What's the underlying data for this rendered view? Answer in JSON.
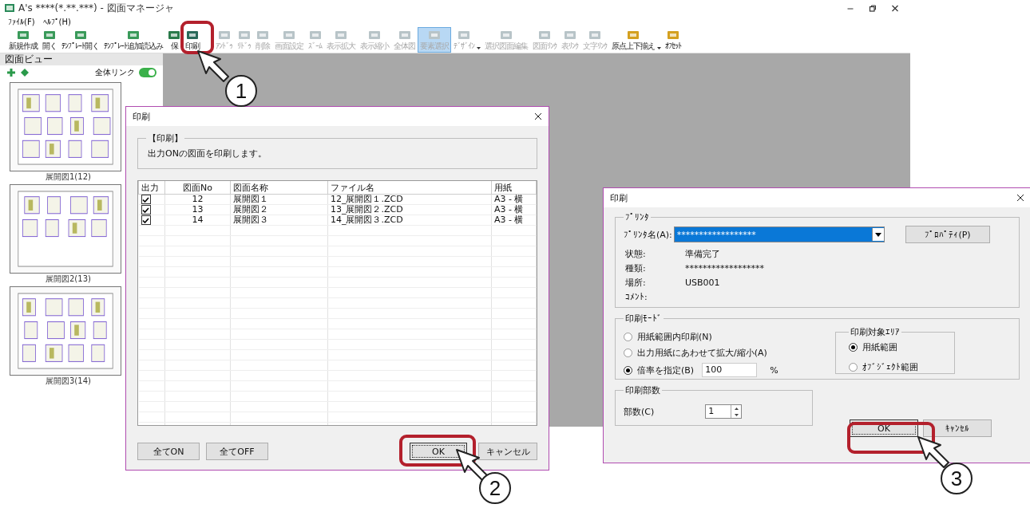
{
  "window": {
    "title": "A's ****(*.**.***) - 図面マネージャ",
    "menu": [
      "ﾌｧｲﾙ(F)",
      "ﾍﾙﾌﾟ(H)"
    ],
    "toolbar": [
      {
        "label": "新規作成",
        "disabled": false,
        "selected": false,
        "dropdown": false
      },
      {
        "label": "開く",
        "disabled": false,
        "selected": false,
        "dropdown": false
      },
      {
        "label": "ﾃﾝﾌﾟﾚｰﾄ開く",
        "disabled": false,
        "selected": false,
        "dropdown": false
      },
      {
        "label": "ﾃﾝﾌﾟﾚｰﾄ追加読込み",
        "disabled": false,
        "selected": false,
        "dropdown": false
      },
      {
        "label": "保",
        "disabled": false,
        "selected": false,
        "dropdown": false
      },
      {
        "label": "印刷",
        "disabled": false,
        "selected": false,
        "dropdown": false
      },
      {
        "label": "ｱﾝﾄﾞｩ",
        "disabled": true,
        "selected": false,
        "dropdown": false
      },
      {
        "label": "ﾘﾄﾞｩ",
        "disabled": true,
        "selected": false,
        "dropdown": false
      },
      {
        "label": "削除",
        "disabled": true,
        "selected": false,
        "dropdown": false
      },
      {
        "label": "画面設定",
        "disabled": true,
        "selected": false,
        "dropdown": false
      },
      {
        "label": "ｽﾞｰﾑ",
        "disabled": true,
        "selected": false,
        "dropdown": false
      },
      {
        "label": "表示拡大",
        "disabled": true,
        "selected": false,
        "dropdown": false
      },
      {
        "label": "表示縮小",
        "disabled": true,
        "selected": false,
        "dropdown": false
      },
      {
        "label": "全体図",
        "disabled": true,
        "selected": false,
        "dropdown": false
      },
      {
        "label": "要素選択",
        "disabled": true,
        "selected": true,
        "dropdown": false
      },
      {
        "label": "ﾃﾞｻﾞｲﾝ",
        "disabled": true,
        "selected": false,
        "dropdown": true
      },
      {
        "label": "選択図面編集",
        "disabled": true,
        "selected": false,
        "dropdown": false
      },
      {
        "label": "図面ﾘﾝｸ",
        "disabled": true,
        "selected": false,
        "dropdown": false
      },
      {
        "label": "表ﾘﾝｸ",
        "disabled": true,
        "selected": false,
        "dropdown": false
      },
      {
        "label": "文字ﾘﾝｸ",
        "disabled": true,
        "selected": false,
        "dropdown": false
      },
      {
        "label": "原点上下揃え",
        "disabled": false,
        "selected": false,
        "dropdown": true
      },
      {
        "label": "ｵﾌｾｯﾄ",
        "disabled": false,
        "selected": false,
        "dropdown": false
      }
    ]
  },
  "drawing_view": {
    "title": "図面ビュー",
    "link_label": "全体リンク",
    "link_on": true,
    "pages": [
      {
        "caption": "展開図1(12)"
      },
      {
        "caption": "展開図2(13)"
      },
      {
        "caption": "展開図3(14)"
      }
    ]
  },
  "print_dialog": {
    "title": "印刷",
    "group_title": "【印刷】",
    "message": "出力ONの図面を印刷します。",
    "columns": [
      "出力",
      "図面No",
      "図面名称",
      "ファイル名",
      "用紙"
    ],
    "rows": [
      {
        "output": true,
        "no": "12",
        "name": "展開図１",
        "file": "12_展開図１.ZCD",
        "paper": "A3 - 横"
      },
      {
        "output": true,
        "no": "13",
        "name": "展開図２",
        "file": "13_展開図２.ZCD",
        "paper": "A3 - 横"
      },
      {
        "output": true,
        "no": "14",
        "name": "展開図３",
        "file": "14_展開図３.ZCD",
        "paper": "A3 - 横"
      }
    ],
    "buttons": [
      {
        "label": "全てON",
        "kind": "left"
      },
      {
        "label": "全てOFF",
        "kind": "left"
      },
      {
        "label": "OK",
        "kind": "default"
      },
      {
        "label": "キャンセル",
        "kind": "right"
      }
    ]
  },
  "printer_dialog": {
    "title": "印刷",
    "printer_group": "ﾌﾟﾘﾝﾀ",
    "printer_label": "ﾌﾟﾘﾝﾀ名(A):",
    "printer_value": "******************",
    "properties_button": "ﾌﾟﾛﾊﾟﾃｨ(P)",
    "info": [
      {
        "label": "状態:",
        "value": "準備完了"
      },
      {
        "label": "種類:",
        "value": "******************"
      },
      {
        "label": "場所:",
        "value": "USB001"
      },
      {
        "label": "ｺﾒﾝﾄ:"
      }
    ],
    "mode_group": "印刷ﾓｰﾄﾞ",
    "modes": [
      {
        "label": "用紙範囲内印刷(N)",
        "selected": false,
        "kind": "plain"
      },
      {
        "label": "出力用紙にあわせて拡大/縮小(A)",
        "selected": false,
        "kind": "plain"
      },
      {
        "label": "倍率を指定(B)",
        "selected": true,
        "kind": "scale",
        "value": "100",
        "unit": "%"
      }
    ],
    "area_group": "印刷対象ｴﾘｱ",
    "areas": [
      {
        "label": "用紙範囲",
        "selected": true
      },
      {
        "label": "ｵﾌﾞｼﾞｪｸﾄ範囲",
        "selected": false
      }
    ],
    "copies_group": "印刷部数",
    "copies_label": "部数(C)",
    "copies_value": "1",
    "buttons": [
      {
        "label": "OK",
        "kind": "default"
      },
      {
        "label": "ｷｬﾝｾﾙ",
        "kind": "right"
      }
    ]
  },
  "callouts": [
    {
      "number": "1"
    },
    {
      "number": "2"
    },
    {
      "number": "3"
    }
  ]
}
